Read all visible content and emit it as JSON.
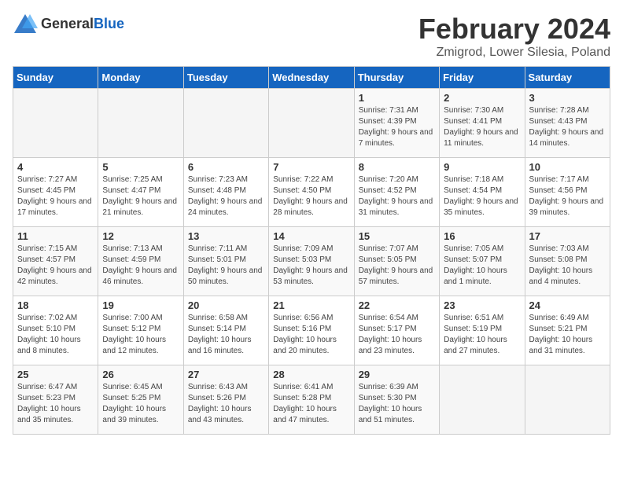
{
  "logo": {
    "general": "General",
    "blue": "Blue"
  },
  "title": "February 2024",
  "location": "Zmigrod, Lower Silesia, Poland",
  "days_of_week": [
    "Sunday",
    "Monday",
    "Tuesday",
    "Wednesday",
    "Thursday",
    "Friday",
    "Saturday"
  ],
  "weeks": [
    [
      {
        "day": null
      },
      {
        "day": null
      },
      {
        "day": null
      },
      {
        "day": null
      },
      {
        "day": "1",
        "sunrise": "Sunrise: 7:31 AM",
        "sunset": "Sunset: 4:39 PM",
        "daylight": "Daylight: 9 hours and 7 minutes."
      },
      {
        "day": "2",
        "sunrise": "Sunrise: 7:30 AM",
        "sunset": "Sunset: 4:41 PM",
        "daylight": "Daylight: 9 hours and 11 minutes."
      },
      {
        "day": "3",
        "sunrise": "Sunrise: 7:28 AM",
        "sunset": "Sunset: 4:43 PM",
        "daylight": "Daylight: 9 hours and 14 minutes."
      }
    ],
    [
      {
        "day": "4",
        "sunrise": "Sunrise: 7:27 AM",
        "sunset": "Sunset: 4:45 PM",
        "daylight": "Daylight: 9 hours and 17 minutes."
      },
      {
        "day": "5",
        "sunrise": "Sunrise: 7:25 AM",
        "sunset": "Sunset: 4:47 PM",
        "daylight": "Daylight: 9 hours and 21 minutes."
      },
      {
        "day": "6",
        "sunrise": "Sunrise: 7:23 AM",
        "sunset": "Sunset: 4:48 PM",
        "daylight": "Daylight: 9 hours and 24 minutes."
      },
      {
        "day": "7",
        "sunrise": "Sunrise: 7:22 AM",
        "sunset": "Sunset: 4:50 PM",
        "daylight": "Daylight: 9 hours and 28 minutes."
      },
      {
        "day": "8",
        "sunrise": "Sunrise: 7:20 AM",
        "sunset": "Sunset: 4:52 PM",
        "daylight": "Daylight: 9 hours and 31 minutes."
      },
      {
        "day": "9",
        "sunrise": "Sunrise: 7:18 AM",
        "sunset": "Sunset: 4:54 PM",
        "daylight": "Daylight: 9 hours and 35 minutes."
      },
      {
        "day": "10",
        "sunrise": "Sunrise: 7:17 AM",
        "sunset": "Sunset: 4:56 PM",
        "daylight": "Daylight: 9 hours and 39 minutes."
      }
    ],
    [
      {
        "day": "11",
        "sunrise": "Sunrise: 7:15 AM",
        "sunset": "Sunset: 4:57 PM",
        "daylight": "Daylight: 9 hours and 42 minutes."
      },
      {
        "day": "12",
        "sunrise": "Sunrise: 7:13 AM",
        "sunset": "Sunset: 4:59 PM",
        "daylight": "Daylight: 9 hours and 46 minutes."
      },
      {
        "day": "13",
        "sunrise": "Sunrise: 7:11 AM",
        "sunset": "Sunset: 5:01 PM",
        "daylight": "Daylight: 9 hours and 50 minutes."
      },
      {
        "day": "14",
        "sunrise": "Sunrise: 7:09 AM",
        "sunset": "Sunset: 5:03 PM",
        "daylight": "Daylight: 9 hours and 53 minutes."
      },
      {
        "day": "15",
        "sunrise": "Sunrise: 7:07 AM",
        "sunset": "Sunset: 5:05 PM",
        "daylight": "Daylight: 9 hours and 57 minutes."
      },
      {
        "day": "16",
        "sunrise": "Sunrise: 7:05 AM",
        "sunset": "Sunset: 5:07 PM",
        "daylight": "Daylight: 10 hours and 1 minute."
      },
      {
        "day": "17",
        "sunrise": "Sunrise: 7:03 AM",
        "sunset": "Sunset: 5:08 PM",
        "daylight": "Daylight: 10 hours and 4 minutes."
      }
    ],
    [
      {
        "day": "18",
        "sunrise": "Sunrise: 7:02 AM",
        "sunset": "Sunset: 5:10 PM",
        "daylight": "Daylight: 10 hours and 8 minutes."
      },
      {
        "day": "19",
        "sunrise": "Sunrise: 7:00 AM",
        "sunset": "Sunset: 5:12 PM",
        "daylight": "Daylight: 10 hours and 12 minutes."
      },
      {
        "day": "20",
        "sunrise": "Sunrise: 6:58 AM",
        "sunset": "Sunset: 5:14 PM",
        "daylight": "Daylight: 10 hours and 16 minutes."
      },
      {
        "day": "21",
        "sunrise": "Sunrise: 6:56 AM",
        "sunset": "Sunset: 5:16 PM",
        "daylight": "Daylight: 10 hours and 20 minutes."
      },
      {
        "day": "22",
        "sunrise": "Sunrise: 6:54 AM",
        "sunset": "Sunset: 5:17 PM",
        "daylight": "Daylight: 10 hours and 23 minutes."
      },
      {
        "day": "23",
        "sunrise": "Sunrise: 6:51 AM",
        "sunset": "Sunset: 5:19 PM",
        "daylight": "Daylight: 10 hours and 27 minutes."
      },
      {
        "day": "24",
        "sunrise": "Sunrise: 6:49 AM",
        "sunset": "Sunset: 5:21 PM",
        "daylight": "Daylight: 10 hours and 31 minutes."
      }
    ],
    [
      {
        "day": "25",
        "sunrise": "Sunrise: 6:47 AM",
        "sunset": "Sunset: 5:23 PM",
        "daylight": "Daylight: 10 hours and 35 minutes."
      },
      {
        "day": "26",
        "sunrise": "Sunrise: 6:45 AM",
        "sunset": "Sunset: 5:25 PM",
        "daylight": "Daylight: 10 hours and 39 minutes."
      },
      {
        "day": "27",
        "sunrise": "Sunrise: 6:43 AM",
        "sunset": "Sunset: 5:26 PM",
        "daylight": "Daylight: 10 hours and 43 minutes."
      },
      {
        "day": "28",
        "sunrise": "Sunrise: 6:41 AM",
        "sunset": "Sunset: 5:28 PM",
        "daylight": "Daylight: 10 hours and 47 minutes."
      },
      {
        "day": "29",
        "sunrise": "Sunrise: 6:39 AM",
        "sunset": "Sunset: 5:30 PM",
        "daylight": "Daylight: 10 hours and 51 minutes."
      },
      {
        "day": null
      },
      {
        "day": null
      }
    ]
  ]
}
